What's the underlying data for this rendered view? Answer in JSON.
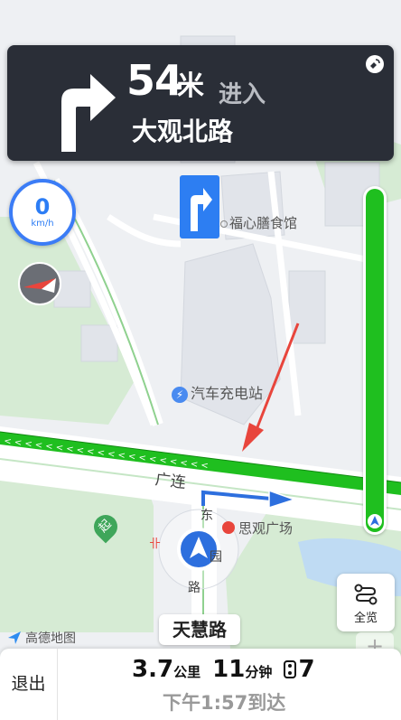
{
  "navigation": {
    "distance_value": "54",
    "distance_unit": "米",
    "action": "进入",
    "next_road": "大观北路"
  },
  "speed": {
    "value": "0",
    "unit": "km/h"
  },
  "map_labels": {
    "poi_canteen": "福心膳食馆",
    "poi_charging": "汽车充电站",
    "poi_plaza": "思观广场",
    "road_main": "广连",
    "road_east_1": "东",
    "road_east_2": "园",
    "road_east_3": "路",
    "poi_marker_qi": "起"
  },
  "current_street": "天慧路",
  "logo_text": "高德地图",
  "controls": {
    "overview_label": "全览",
    "zoom_in": "+",
    "zoom_out": "−"
  },
  "trip": {
    "exit_label": "退出",
    "remaining_distance": "3.7",
    "distance_unit": "公里",
    "remaining_time": "11",
    "time_unit": "分钟",
    "traffic_lights": "7",
    "arrival_text": "下午1:57到达"
  },
  "colors": {
    "route": "#1fbf1f",
    "accent": "#2d7ef2",
    "banner": "#2a2e37",
    "red_arrow": "#e8453c"
  }
}
